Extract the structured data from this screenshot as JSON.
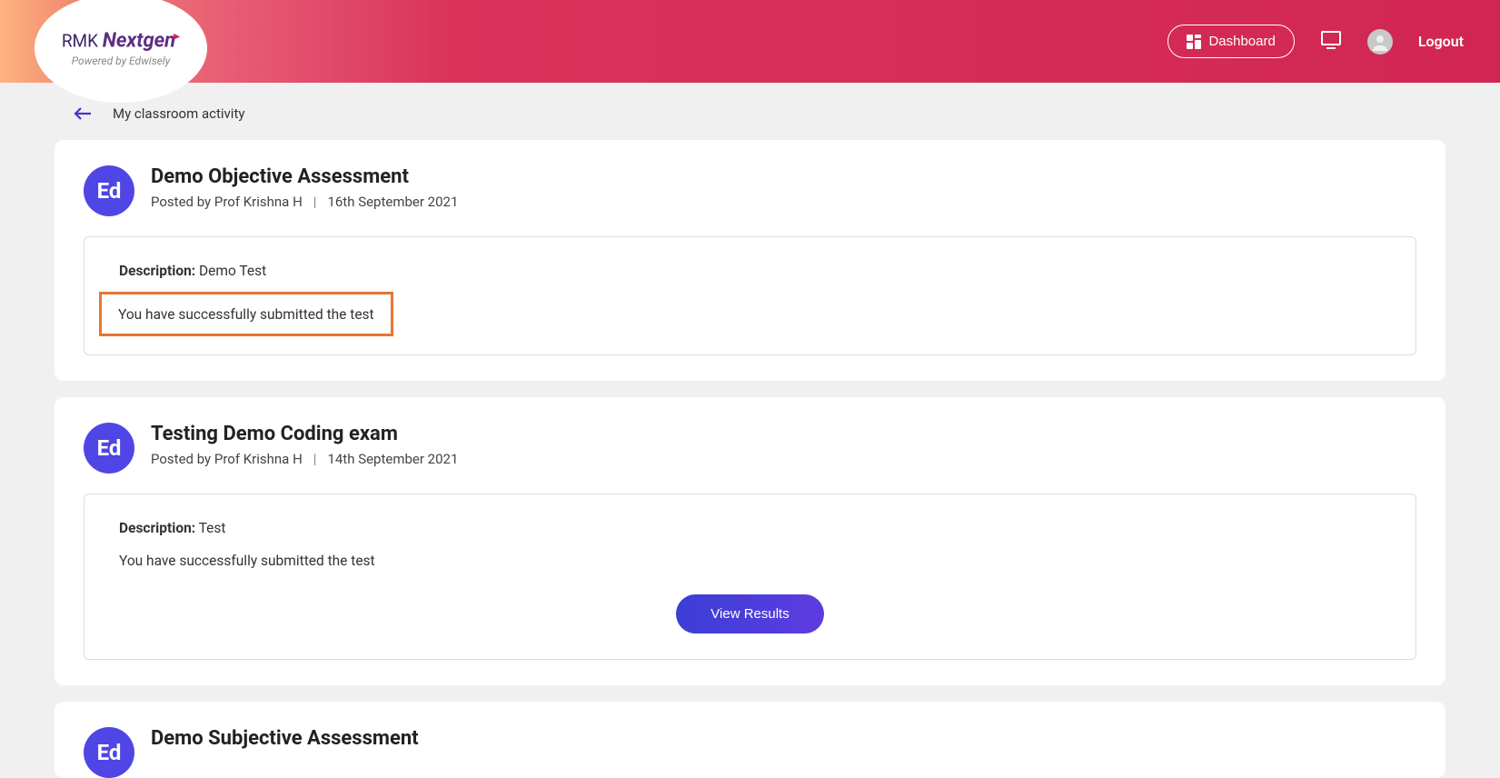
{
  "header": {
    "logo_prefix": "RMK",
    "logo_main": "Nextgen",
    "logo_sub": "Powered by Edwisely",
    "dashboard_label": "Dashboard",
    "logout_label": "Logout"
  },
  "breadcrumb": {
    "title": "My classroom activity"
  },
  "cards": [
    {
      "badge": "Ed",
      "title": "Demo Objective Assessment",
      "posted_by": "Posted by Prof Krishna H",
      "date": "16th September 2021",
      "description_label": "Description:",
      "description_value": "Demo Test",
      "status": "You have successfully submitted the test",
      "highlighted": true,
      "has_button": false
    },
    {
      "badge": "Ed",
      "title": "Testing Demo Coding exam",
      "posted_by": "Posted by Prof Krishna H",
      "date": "14th September 2021",
      "description_label": "Description:",
      "description_value": "Test",
      "status": "You have successfully submitted the test",
      "highlighted": false,
      "has_button": true,
      "button_label": "View Results"
    },
    {
      "badge": "Ed",
      "title": "Demo Subjective Assessment",
      "posted_by": "",
      "date": "",
      "description_label": "",
      "description_value": "",
      "status": "",
      "highlighted": false,
      "has_button": false
    }
  ]
}
